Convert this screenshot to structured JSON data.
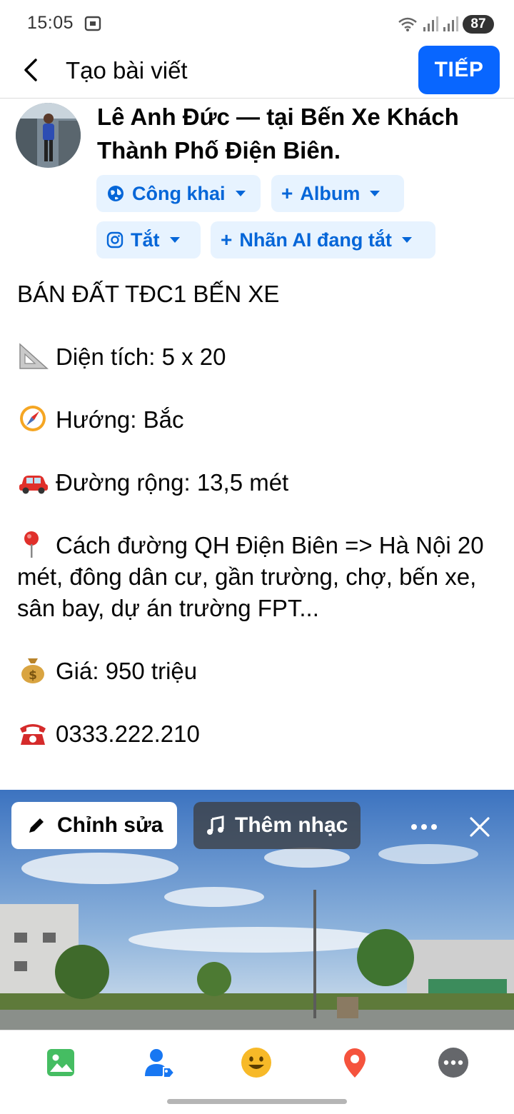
{
  "status_bar": {
    "time": "15:05",
    "battery": "87",
    "icons": [
      "screen-cast-icon",
      "wifi-icon",
      "signal-icon",
      "signal-icon"
    ]
  },
  "header": {
    "title": "Tạo bài viết",
    "next_label": "TIẾP",
    "accent_color": "#0866ff"
  },
  "author": {
    "line": "Lê Anh Đức — tại Bến Xe Khách Thành Phố Điện Biên."
  },
  "chips": {
    "audience": "Công khai",
    "album": "Album",
    "instagram": "Tắt",
    "ai_label": "Nhãn AI đang tắt"
  },
  "post": {
    "title": "BÁN ĐẤT TĐC1 BẾN XE",
    "area": "Diện tích: 5 x 20",
    "direction": "Hướng: Bắc",
    "road": "Đường rộng: 13,5 mét",
    "location": "Cách đường QH Điện Biên => Hà Nội 20 mét, đông dân cư, gần trường, chợ, bến xe, sân bay, dự án trường FPT...",
    "price": "Giá: 950 triệu",
    "phone": "0333.222.210"
  },
  "photo": {
    "edit_label": "Chỉnh sửa",
    "music_label": "Thêm nhạc"
  },
  "toolbar": {
    "icons": [
      "photo-icon",
      "tag-people-icon",
      "feeling-icon",
      "location-icon",
      "more-icon"
    ]
  }
}
